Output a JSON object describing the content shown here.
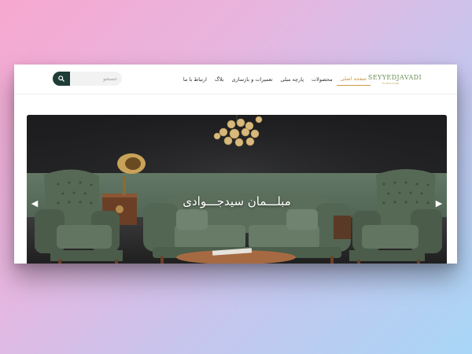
{
  "header": {
    "logo_text": "SEYYEDJAVADI",
    "logo_sub": "FURNITURE",
    "nav": [
      {
        "label": "صفحه اصلی",
        "active": true
      },
      {
        "label": "محصولات",
        "active": false
      },
      {
        "label": "پارچه مبلی",
        "active": false
      },
      {
        "label": "تعمیرات و بازسازی",
        "active": false
      },
      {
        "label": "بلاگ",
        "active": false
      },
      {
        "label": "ارتباط با ما",
        "active": false
      }
    ],
    "search": {
      "placeholder": "جستجو",
      "icon": "search-icon"
    }
  },
  "hero": {
    "title": "مبلـــمان سیدجـــوادی",
    "prev_icon": "chevron-left-icon",
    "next_icon": "chevron-right-icon"
  },
  "colors": {
    "accent": "#c79d45",
    "search_button": "#1e3d37",
    "sofa": "#5b6e5b",
    "wall": "#232325"
  }
}
